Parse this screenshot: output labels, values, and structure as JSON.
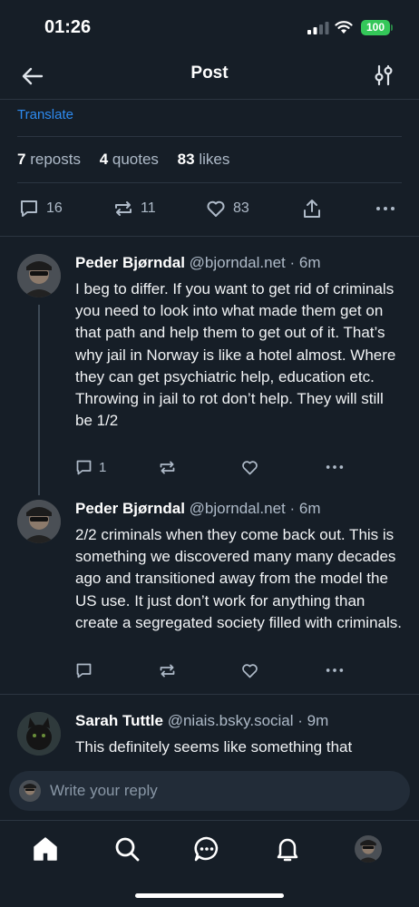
{
  "status_bar": {
    "time": "01:26",
    "battery": "100"
  },
  "header": {
    "title": "Post"
  },
  "post": {
    "translate_label": "Translate",
    "stats": {
      "reposts_count": "7",
      "reposts_label": "reposts",
      "quotes_count": "4",
      "quotes_label": "quotes",
      "likes_count": "83",
      "likes_label": "likes"
    },
    "actions": {
      "replies": "16",
      "reposts": "11",
      "likes": "83"
    }
  },
  "replies": [
    {
      "name": "Peder Bjørndal",
      "handle": "@bjorndal.net",
      "time": "· 6m",
      "text": "I beg to differ. If you want to get rid of criminals you need to look into what made them get on that path and help them to get out of it. That’s why jail in Norway is like a hotel almost. Where they can get psychiatric help, education etc. Throwing in jail to rot don’t help. They will still be 1/2",
      "reply_count": "1"
    },
    {
      "name": "Peder Bjørndal",
      "handle": "@bjorndal.net",
      "time": "· 6m",
      "text": "2/2 criminals when they come back out. This is something we discovered many many decades ago and transitioned away from the model the US use. It just don’t work for anything than create a segregated society filled with criminals.",
      "reply_count": ""
    },
    {
      "name": "Sarah Tuttle",
      "handle": "@niais.bsky.social",
      "time": "· 9m",
      "text": "This definitely seems like something that"
    }
  ],
  "compose": {
    "placeholder": "Write your reply"
  },
  "colors": {
    "background": "#161e27",
    "accent": "#2e8bf0",
    "muted": "#aebac8",
    "battery": "#34c759"
  }
}
